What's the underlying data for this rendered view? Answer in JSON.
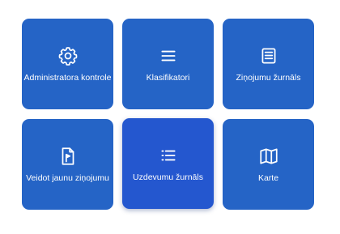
{
  "tiles": [
    {
      "label": "Administratora kontrole",
      "icon": "gear-icon"
    },
    {
      "label": "Klasifikatori",
      "icon": "menu-icon"
    },
    {
      "label": "Ziņojumu žurnāls",
      "icon": "journal-icon"
    },
    {
      "label": "Veidot jaunu ziņojumu",
      "icon": "new-report-flag-icon"
    },
    {
      "label": "Uzdevumu žurnāls",
      "icon": "task-list-icon"
    },
    {
      "label": "Karte",
      "icon": "map-icon"
    }
  ],
  "colors": {
    "tile": "#2564c6",
    "tile_active": "#2457cf",
    "text": "#ffffff",
    "background": "#ffffff"
  }
}
